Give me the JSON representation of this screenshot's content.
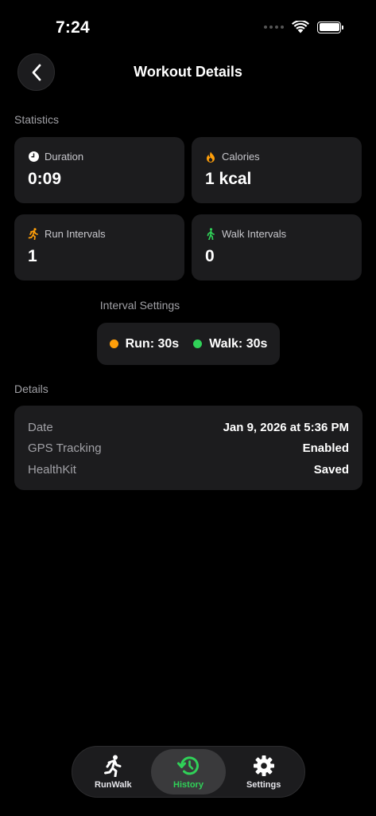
{
  "status_bar": {
    "time": "7:24"
  },
  "header": {
    "title": "Workout Details"
  },
  "statistics": {
    "section_label": "Statistics",
    "cards": [
      {
        "label": "Duration",
        "value": "0:09",
        "icon": "clock-icon"
      },
      {
        "label": "Calories",
        "value": "1 kcal",
        "icon": "flame-icon"
      },
      {
        "label": "Run Intervals",
        "value": "1",
        "icon": "running-figure-icon"
      },
      {
        "label": "Walk Intervals",
        "value": "0",
        "icon": "walking-figure-icon"
      }
    ]
  },
  "interval_settings": {
    "label": "Interval Settings",
    "run": "Run: 30s",
    "walk": "Walk: 30s",
    "run_color": "#ff9f0a",
    "walk_color": "#30d158"
  },
  "details": {
    "section_label": "Details",
    "rows": [
      {
        "label": "Date",
        "value": "Jan 9, 2026 at 5:36 PM"
      },
      {
        "label": "GPS Tracking",
        "value": "Enabled"
      },
      {
        "label": "HealthKit",
        "value": "Saved"
      }
    ]
  },
  "tab_bar": {
    "tabs": [
      {
        "label": "RunWalk",
        "icon": "running-figure-icon",
        "active": false
      },
      {
        "label": "History",
        "icon": "history-clock-icon",
        "active": true
      },
      {
        "label": "Settings",
        "icon": "gear-icon",
        "active": false
      }
    ],
    "accent": "#30d158"
  }
}
